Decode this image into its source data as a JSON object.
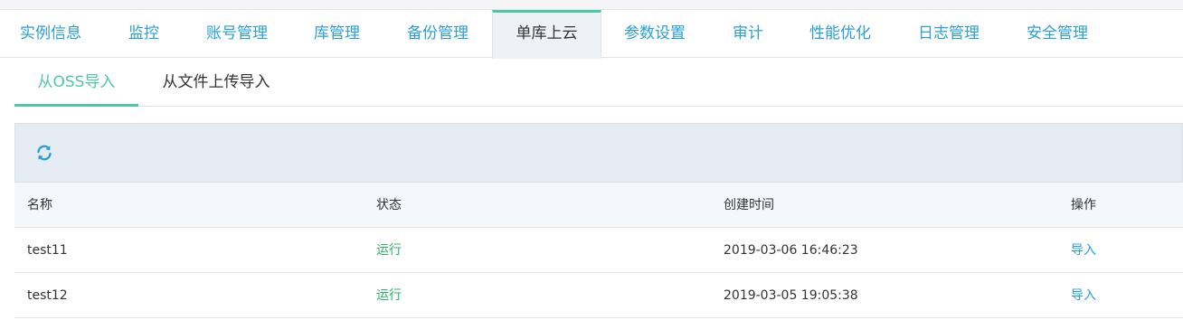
{
  "tabs": [
    {
      "label": "实例信息"
    },
    {
      "label": "监控"
    },
    {
      "label": "账号管理"
    },
    {
      "label": "库管理"
    },
    {
      "label": "备份管理"
    },
    {
      "label": "单库上云",
      "active": true
    },
    {
      "label": "参数设置"
    },
    {
      "label": "审计"
    },
    {
      "label": "性能优化"
    },
    {
      "label": "日志管理"
    },
    {
      "label": "安全管理"
    }
  ],
  "subtabs": [
    {
      "label": "从OSS导入",
      "active": true
    },
    {
      "label": "从文件上传导入"
    }
  ],
  "toolbar": {
    "refresh_icon": "refresh-icon"
  },
  "table": {
    "headers": [
      "名称",
      "状态",
      "创建时间",
      "操作"
    ],
    "rows": [
      {
        "name": "test11",
        "status": "运行",
        "created": "2019-03-06 16:46:23",
        "action": "导入"
      },
      {
        "name": "test12",
        "status": "运行",
        "created": "2019-03-05 19:05:38",
        "action": "导入"
      }
    ]
  },
  "colors": {
    "accent": "#50c8a8",
    "link": "#2a9fd6",
    "status_running": "#2cb36b",
    "toolbar_bg": "#e4ebf3"
  }
}
